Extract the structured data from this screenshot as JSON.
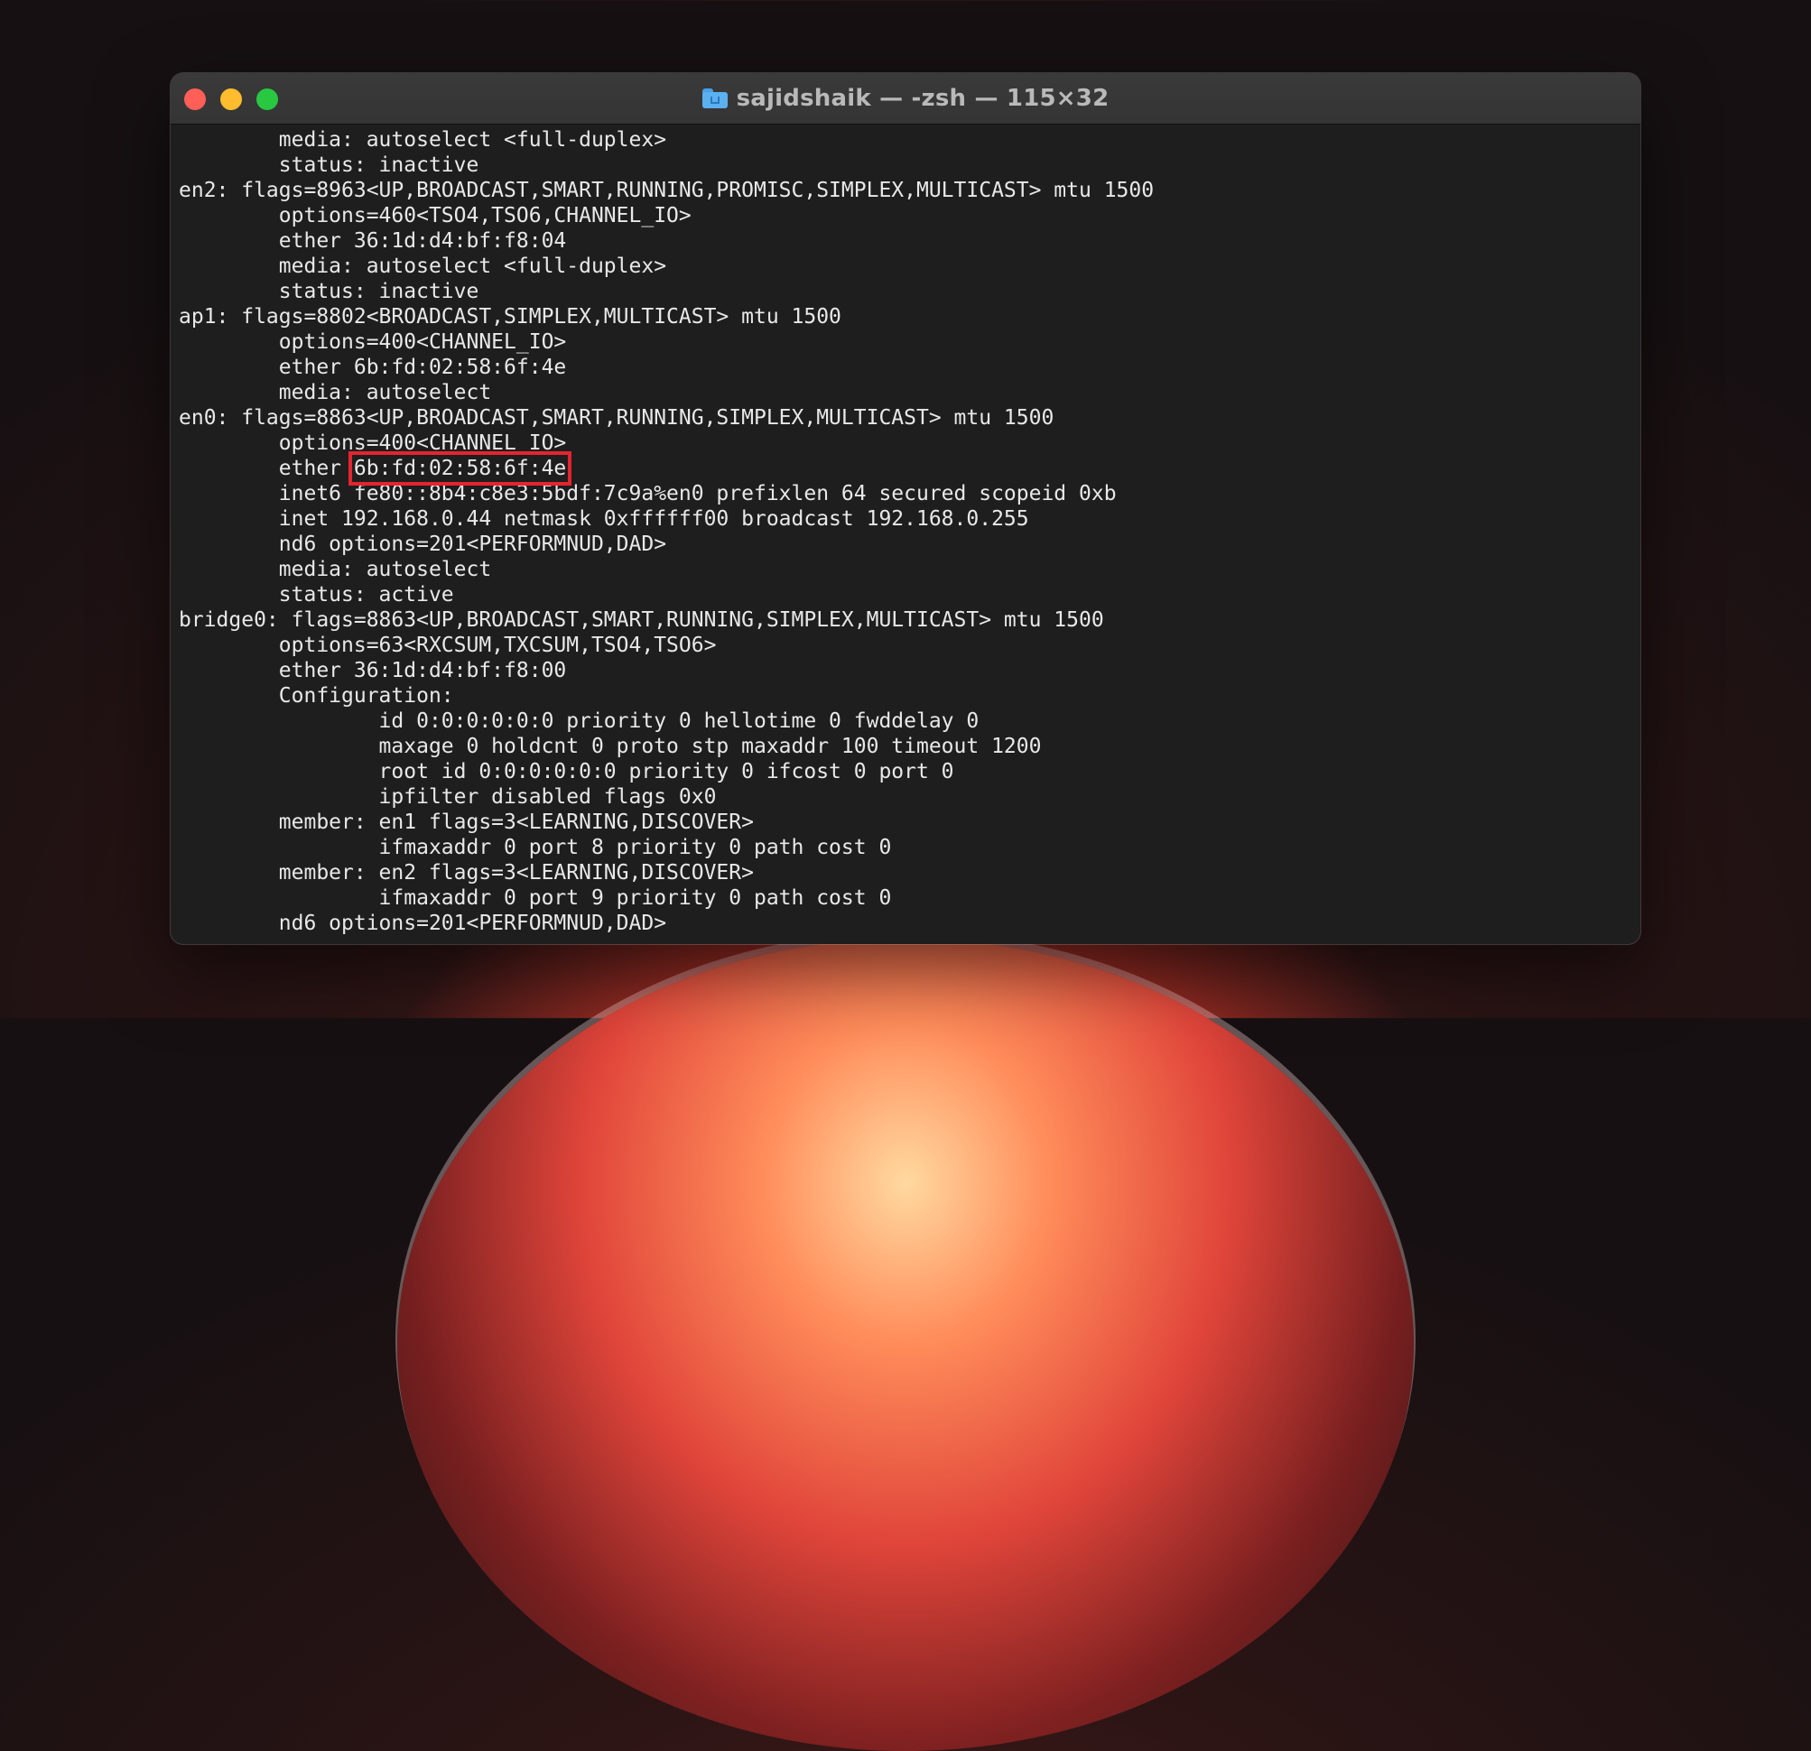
{
  "window": {
    "title": "sajidshaik — -zsh — 115×32",
    "colors": {
      "close": "#ff5f57",
      "minimize": "#febc2e",
      "maximize": "#28c840",
      "highlight": "#e3252f"
    },
    "title_icon": "folder-home-icon"
  },
  "terminal": {
    "lines": [
      {
        "text": "        media: autoselect <full-duplex>"
      },
      {
        "text": "        status: inactive"
      },
      {
        "text": "en2: flags=8963<UP,BROADCAST,SMART,RUNNING,PROMISC,SIMPLEX,MULTICAST> mtu 1500"
      },
      {
        "text": "        options=460<TSO4,TSO6,CHANNEL_IO>"
      },
      {
        "text": "        ether 36:1d:d4:bf:f8:04"
      },
      {
        "text": "        media: autoselect <full-duplex>"
      },
      {
        "text": "        status: inactive"
      },
      {
        "text": "ap1: flags=8802<BROADCAST,SIMPLEX,MULTICAST> mtu 1500"
      },
      {
        "text": "        options=400<CHANNEL_IO>"
      },
      {
        "text": "        ether 6b:fd:02:58:6f:4e"
      },
      {
        "text": "        media: autoselect"
      },
      {
        "text": "en0: flags=8863<UP,BROADCAST,SMART,RUNNING,SIMPLEX,MULTICAST> mtu 1500"
      },
      {
        "text": "        options=400<CHANNEL_IO>"
      },
      {
        "prefix": "        ether ",
        "highlight": "6b:fd:02:58:6f:4e"
      },
      {
        "text": "        inet6 fe80::8b4:c8e3:5bdf:7c9a%en0 prefixlen 64 secured scopeid 0xb"
      },
      {
        "text": "        inet 192.168.0.44 netmask 0xffffff00 broadcast 192.168.0.255"
      },
      {
        "text": "        nd6 options=201<PERFORMNUD,DAD>"
      },
      {
        "text": "        media: autoselect"
      },
      {
        "text": "        status: active"
      },
      {
        "text": "bridge0: flags=8863<UP,BROADCAST,SMART,RUNNING,SIMPLEX,MULTICAST> mtu 1500"
      },
      {
        "text": "        options=63<RXCSUM,TXCSUM,TSO4,TSO6>"
      },
      {
        "text": "        ether 36:1d:d4:bf:f8:00"
      },
      {
        "text": "        Configuration:"
      },
      {
        "text": "                id 0:0:0:0:0:0 priority 0 hellotime 0 fwddelay 0"
      },
      {
        "text": "                maxage 0 holdcnt 0 proto stp maxaddr 100 timeout 1200"
      },
      {
        "text": "                root id 0:0:0:0:0:0 priority 0 ifcost 0 port 0"
      },
      {
        "text": "                ipfilter disabled flags 0x0"
      },
      {
        "text": "        member: en1 flags=3<LEARNING,DISCOVER>"
      },
      {
        "text": "                ifmaxaddr 0 port 8 priority 0 path cost 0"
      },
      {
        "text": "        member: en2 flags=3<LEARNING,DISCOVER>"
      },
      {
        "text": "                ifmaxaddr 0 port 9 priority 0 path cost 0"
      },
      {
        "text": "        nd6 options=201<PERFORMNUD,DAD>"
      }
    ]
  }
}
